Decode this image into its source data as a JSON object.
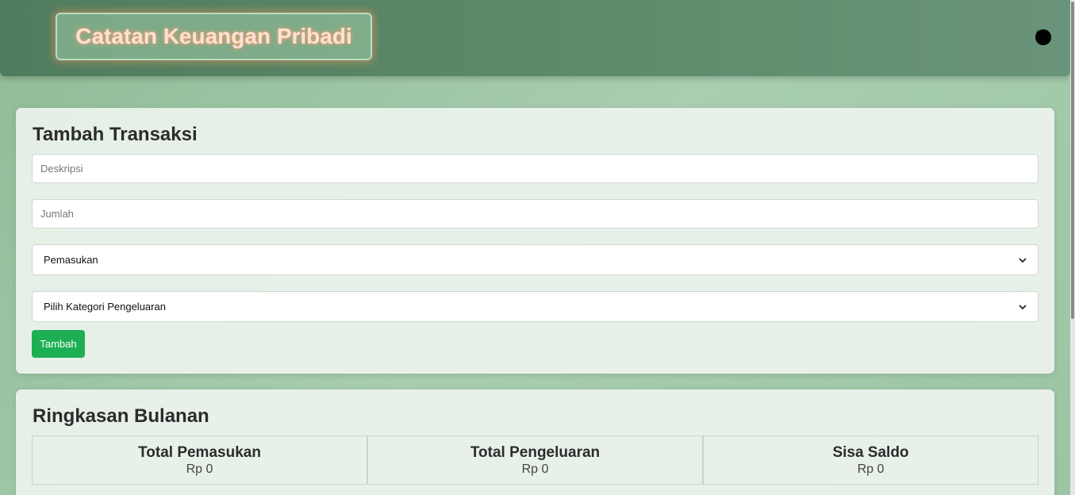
{
  "header": {
    "title": "Catatan Keuangan Pribadi",
    "theme_toggle_icon": "moon-icon"
  },
  "form": {
    "title": "Tambah Transaksi",
    "description_placeholder": "Deskripsi",
    "amount_placeholder": "Jumlah",
    "type_selected": "Pemasukan",
    "category_selected": "Pilih Kategori Pengeluaran",
    "submit_label": "Tambah"
  },
  "summary": {
    "title": "Ringkasan Bulanan",
    "items": [
      {
        "label": "Total Pemasukan",
        "value": "Rp 0"
      },
      {
        "label": "Total Pengeluaran",
        "value": "Rp 0"
      },
      {
        "label": "Sisa Saldo",
        "value": "Rp 0"
      }
    ]
  },
  "colors": {
    "header": "#5a8868",
    "button": "#1daf54",
    "title_text": "#fde1d5"
  }
}
